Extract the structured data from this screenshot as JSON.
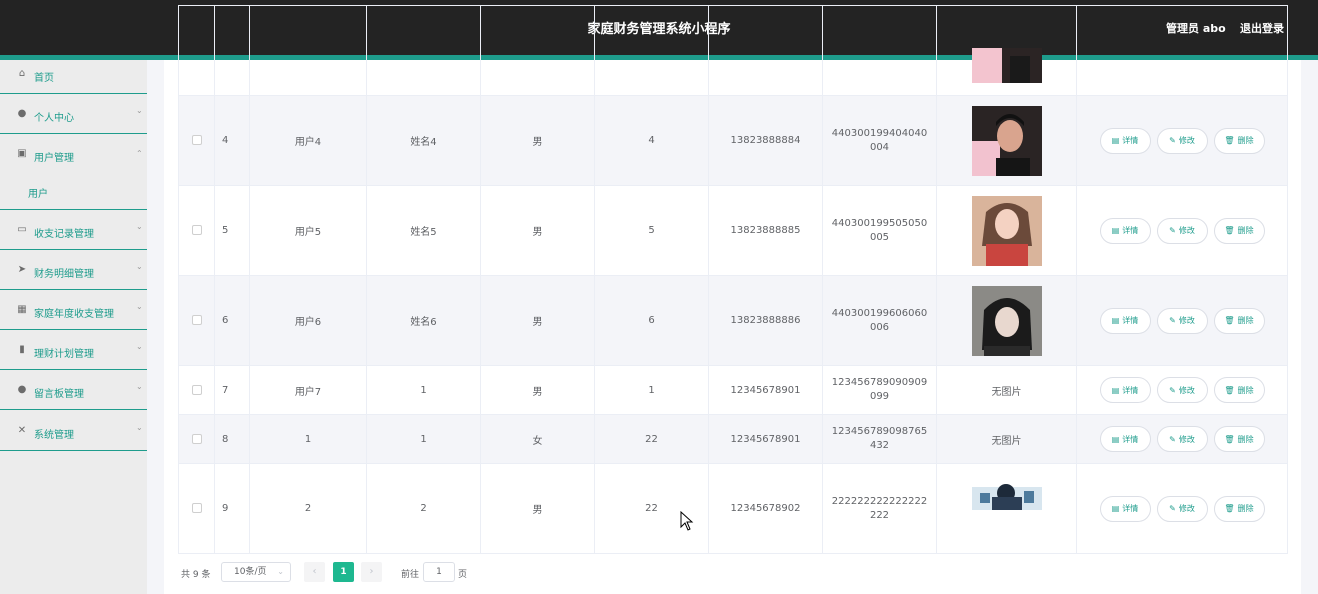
{
  "header": {
    "title": "家庭财务管理系统小程序",
    "admin": "管理员 abo",
    "logout": "退出登录"
  },
  "sidebar": {
    "items": [
      {
        "label": "首页",
        "icon": "home-icon",
        "glyph": "⌂",
        "chev": ""
      },
      {
        "label": "个人中心",
        "icon": "user-icon",
        "glyph": "●",
        "chev": "⌄"
      },
      {
        "label": "用户管理",
        "icon": "clipboard-icon",
        "glyph": "▣",
        "chev": "⌃"
      },
      {
        "label": "收支记录管理",
        "icon": "chat-icon",
        "glyph": "▭",
        "chev": "⌄"
      },
      {
        "label": "财务明细管理",
        "icon": "send-icon",
        "glyph": "➤",
        "chev": "⌄"
      },
      {
        "label": "家庭年度收支管理",
        "icon": "grid-icon",
        "glyph": "▦",
        "chev": "⌄"
      },
      {
        "label": "理财计划管理",
        "icon": "bar-chart-icon",
        "glyph": "▮",
        "chev": "⌄"
      },
      {
        "label": "留言板管理",
        "icon": "bulb-icon",
        "glyph": "●",
        "chev": "⌄"
      },
      {
        "label": "系统管理",
        "icon": "bell-off-icon",
        "glyph": "✕",
        "chev": "⌄"
      }
    ],
    "subitem": "用户"
  },
  "table": {
    "rows": [
      {
        "idx": "4",
        "username": "用户4",
        "name": "姓名4",
        "gender": "男",
        "age": "4",
        "phone": "13823888884",
        "idno": "440300199404040004",
        "photo": "portrait-male-pink",
        "photo_text": ""
      },
      {
        "idx": "5",
        "username": "用户5",
        "name": "姓名5",
        "gender": "男",
        "age": "5",
        "phone": "13823888885",
        "idno": "440300199505050005",
        "photo": "portrait-girl-red",
        "photo_text": ""
      },
      {
        "idx": "6",
        "username": "用户6",
        "name": "姓名6",
        "gender": "男",
        "age": "6",
        "phone": "13823888886",
        "idno": "440300199606060006",
        "photo": "portrait-girl-dark",
        "photo_text": ""
      },
      {
        "idx": "7",
        "username": "用户7",
        "name": "1",
        "gender": "男",
        "age": "1",
        "phone": "12345678901",
        "idno": "123456789090909099",
        "photo": "",
        "photo_text": "无图片"
      },
      {
        "idx": "8",
        "username": "1",
        "name": "1",
        "gender": "女",
        "age": "22",
        "phone": "12345678901",
        "idno": "123456789098765432",
        "photo": "",
        "photo_text": "无图片"
      },
      {
        "idx": "9",
        "username": "2",
        "name": "2",
        "gender": "男",
        "age": "22",
        "phone": "12345678902",
        "idno": "222222222222222222",
        "photo": "game-character",
        "photo_text": ""
      }
    ],
    "actions": {
      "detail": "详情",
      "edit": "修改",
      "delete": "删除"
    }
  },
  "pagination": {
    "total": "共 9 条",
    "page_size": "10条/页",
    "current_page": "1",
    "goto_label": "前往",
    "goto_value": "1",
    "page_unit": "页"
  },
  "colors": {
    "accent": "#1e9c8c",
    "topbar": "#232323",
    "pager_active": "#1eb890"
  }
}
